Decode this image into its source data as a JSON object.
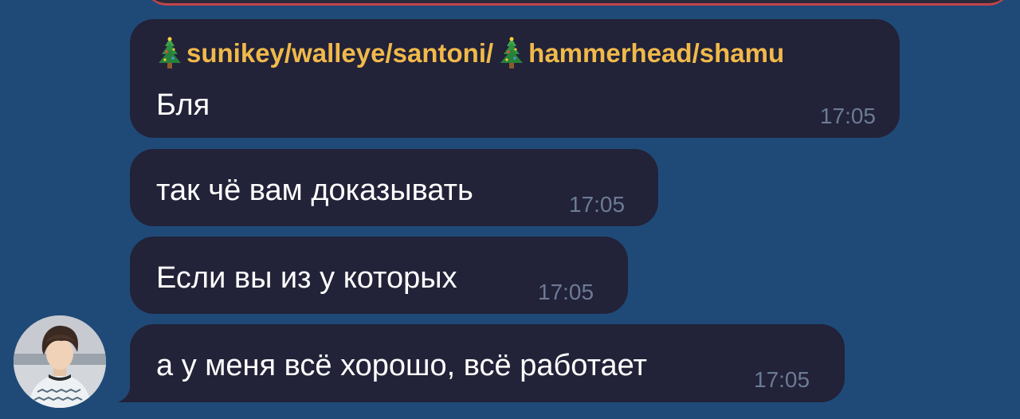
{
  "colors": {
    "background": "#1f4a78",
    "bubble": "#222238",
    "sender_name": "#f0b94a",
    "timestamp": "#6c7b95",
    "text": "#ffffff"
  },
  "messages": [
    {
      "sender_part1": "sunikey/walleye/santoni/",
      "sender_part2": " hammerhead/shamu",
      "sender_icon": "christmas-tree-icon",
      "text": "Бля",
      "time": "17:05"
    },
    {
      "text": "так чё вам доказывать",
      "time": "17:05"
    },
    {
      "text": "Если вы из у которых",
      "time": "17:05"
    },
    {
      "text": "а у меня всё хорошо, всё работает",
      "time": "17:05"
    }
  ],
  "avatar": {
    "icon": "user-avatar"
  }
}
